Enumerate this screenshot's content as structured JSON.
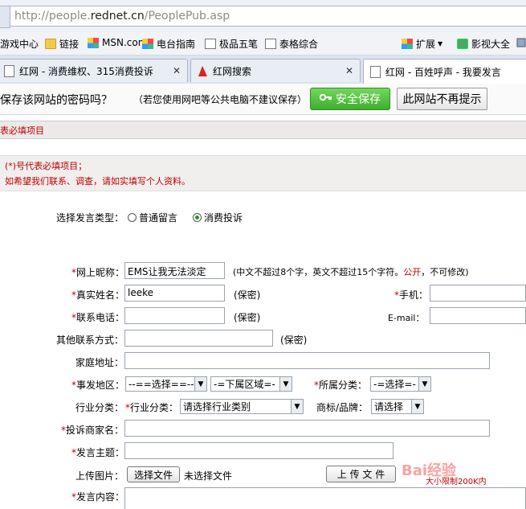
{
  "address_bar": {
    "url_prefix": "http://people.",
    "url_domain": "rednet.cn",
    "url_path": "/PeoplePub.asp"
  },
  "favorites": [
    {
      "label": "游戏中心",
      "icon": "page-icon"
    },
    {
      "label": "链接",
      "icon": "folder-icon"
    },
    {
      "label": "MSN.com",
      "icon": "msn-icon"
    },
    {
      "label": "电台指南",
      "icon": "msn-icon"
    },
    {
      "label": "极品五笔",
      "icon": "page-icon"
    },
    {
      "label": "泰格综合",
      "icon": "page-icon"
    },
    {
      "label": "扩展",
      "icon": "extension-icon"
    },
    {
      "label": "影视大全",
      "icon": "video-icon"
    }
  ],
  "tabs": [
    {
      "title": "红网 - 消费维权、315消费投诉"
    },
    {
      "title": "红网搜索"
    },
    {
      "title": "红网 - 百姓呼声 - 我要发言"
    }
  ],
  "password_bar": {
    "question": "保存该网站的密码吗？",
    "note": "（若您使用网吧等公共电脑不建议保存）",
    "save_label": "安全保存",
    "never_label": "此网站不再提示"
  },
  "form": {
    "header": "表必填项目",
    "notice_line1": "(*)号代表必填项目；",
    "notice_line2": "如希望我们联系、调查，请如实填写个人资料。",
    "type_label": "选择发言类型：",
    "type_opt1": "普通留言",
    "type_opt2": "消费投诉",
    "nickname_label": "网上昵称：",
    "nickname_value": "EMS让我无法淡定",
    "nickname_hint_a": "(中文不超过8个字，英文不超过15个字符。",
    "nickname_hint_public": "公开",
    "nickname_hint_b": "，不可修改)",
    "realname_label": "真实姓名：",
    "realname_value": "leeke",
    "secret": "(保密)",
    "mobile_label": "手机：",
    "phone_label": "联系电话：",
    "email_label": "E-mail：",
    "other_contact_label": "其他联系方式：",
    "address_label": "家庭地址：",
    "region_label": "事发地区：",
    "region_select": "--==选择==--",
    "district_select": "-=下属区域=-",
    "category_label": "所属分类：",
    "category_select": "-=选择=-",
    "industry_outer_label": "行业分类：",
    "industry_label": "行业分类：",
    "industry_select": "请选择行业类别",
    "brand_label": "商标/品牌：",
    "brand_select": "请选择",
    "merchant_label": "投诉商家名：",
    "subject_label": "发言主题：",
    "upload_label": "上传图片：",
    "choose_file": "选择文件",
    "no_file": "未选择文件",
    "upload_button": "上 传 文 件",
    "size_limit": "大小限制200K内",
    "content_label": "发言内容：",
    "star": "*"
  },
  "watermark": "Bai经验"
}
